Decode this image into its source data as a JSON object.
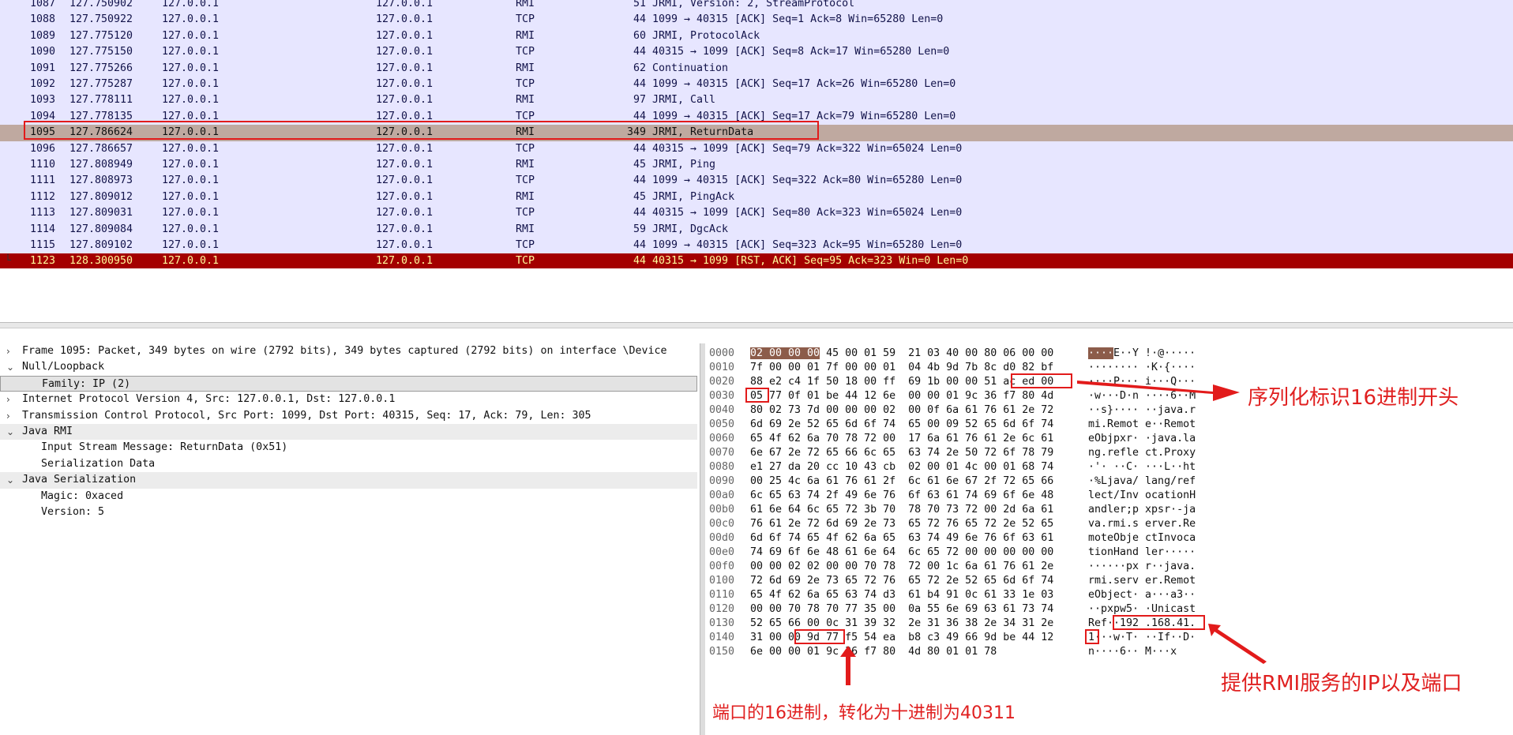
{
  "packets": [
    {
      "no": "1087",
      "time": "127.750902",
      "src": "127.0.0.1",
      "dst": "127.0.0.1",
      "proto": "RMI",
      "len": "51",
      "info": "JRMI, Version: 2, StreamProtocol"
    },
    {
      "no": "1088",
      "time": "127.750922",
      "src": "127.0.0.1",
      "dst": "127.0.0.1",
      "proto": "TCP",
      "len": "44",
      "info": "1099 → 40315 [ACK] Seq=1 Ack=8 Win=65280 Len=0"
    },
    {
      "no": "1089",
      "time": "127.775120",
      "src": "127.0.0.1",
      "dst": "127.0.0.1",
      "proto": "RMI",
      "len": "60",
      "info": "JRMI, ProtocolAck"
    },
    {
      "no": "1090",
      "time": "127.775150",
      "src": "127.0.0.1",
      "dst": "127.0.0.1",
      "proto": "TCP",
      "len": "44",
      "info": "40315 → 1099 [ACK] Seq=8 Ack=17 Win=65280 Len=0"
    },
    {
      "no": "1091",
      "time": "127.775266",
      "src": "127.0.0.1",
      "dst": "127.0.0.1",
      "proto": "RMI",
      "len": "62",
      "info": "Continuation"
    },
    {
      "no": "1092",
      "time": "127.775287",
      "src": "127.0.0.1",
      "dst": "127.0.0.1",
      "proto": "TCP",
      "len": "44",
      "info": "1099 → 40315 [ACK] Seq=17 Ack=26 Win=65280 Len=0"
    },
    {
      "no": "1093",
      "time": "127.778111",
      "src": "127.0.0.1",
      "dst": "127.0.0.1",
      "proto": "RMI",
      "len": "97",
      "info": "JRMI, Call"
    },
    {
      "no": "1094",
      "time": "127.778135",
      "src": "127.0.0.1",
      "dst": "127.0.0.1",
      "proto": "TCP",
      "len": "44",
      "info": "1099 → 40315 [ACK] Seq=17 Ack=79 Win=65280 Len=0"
    },
    {
      "no": "1095",
      "time": "127.786624",
      "src": "127.0.0.1",
      "dst": "127.0.0.1",
      "proto": "RMI",
      "len": "349",
      "info": "JRMI, ReturnData"
    },
    {
      "no": "1096",
      "time": "127.786657",
      "src": "127.0.0.1",
      "dst": "127.0.0.1",
      "proto": "TCP",
      "len": "44",
      "info": "40315 → 1099 [ACK] Seq=79 Ack=322 Win=65024 Len=0"
    },
    {
      "no": "1110",
      "time": "127.808949",
      "src": "127.0.0.1",
      "dst": "127.0.0.1",
      "proto": "RMI",
      "len": "45",
      "info": "JRMI, Ping"
    },
    {
      "no": "1111",
      "time": "127.808973",
      "src": "127.0.0.1",
      "dst": "127.0.0.1",
      "proto": "TCP",
      "len": "44",
      "info": "1099 → 40315 [ACK] Seq=322 Ack=80 Win=65280 Len=0"
    },
    {
      "no": "1112",
      "time": "127.809012",
      "src": "127.0.0.1",
      "dst": "127.0.0.1",
      "proto": "RMI",
      "len": "45",
      "info": "JRMI, PingAck"
    },
    {
      "no": "1113",
      "time": "127.809031",
      "src": "127.0.0.1",
      "dst": "127.0.0.1",
      "proto": "TCP",
      "len": "44",
      "info": "40315 → 1099 [ACK] Seq=80 Ack=323 Win=65024 Len=0"
    },
    {
      "no": "1114",
      "time": "127.809084",
      "src": "127.0.0.1",
      "dst": "127.0.0.1",
      "proto": "RMI",
      "len": "59",
      "info": "JRMI, DgcAck"
    },
    {
      "no": "1115",
      "time": "127.809102",
      "src": "127.0.0.1",
      "dst": "127.0.0.1",
      "proto": "TCP",
      "len": "44",
      "info": "1099 → 40315 [ACK] Seq=323 Ack=95 Win=65280 Len=0"
    },
    {
      "no": "1123",
      "time": "128.300950",
      "src": "127.0.0.1",
      "dst": "127.0.0.1",
      "proto": "TCP",
      "len": "44",
      "info": "40315 → 1099 [RST, ACK] Seq=95 Ack=323 Win=0 Len=0"
    }
  ],
  "details": [
    {
      "arrow": "›",
      "text": "Frame 1095: Packet, 349 bytes on wire (2792 bits), 349 bytes captured (2792 bits) on interface \\Device",
      "level": "top"
    },
    {
      "arrow": "⌄",
      "text": "Null/Loopback",
      "level": "top"
    },
    {
      "arrow": "",
      "text": "Family: IP (2)",
      "level": "child"
    },
    {
      "arrow": "›",
      "text": "Internet Protocol Version 4, Src: 127.0.0.1, Dst: 127.0.0.1",
      "level": "top"
    },
    {
      "arrow": "›",
      "text": "Transmission Control Protocol, Src Port: 1099, Dst Port: 40315, Seq: 17, Ack: 79, Len: 305",
      "level": "top"
    },
    {
      "arrow": "⌄",
      "text": "Java RMI",
      "level": "top"
    },
    {
      "arrow": "",
      "text": "Input Stream Message: ReturnData (0x51)",
      "level": "child"
    },
    {
      "arrow": "",
      "text": "Serialization Data",
      "level": "child"
    },
    {
      "arrow": "⌄",
      "text": "Java Serialization",
      "level": "top"
    },
    {
      "arrow": "",
      "text": "Magic: 0xaced",
      "level": "child"
    },
    {
      "arrow": "",
      "text": "Version: 5",
      "level": "child"
    }
  ],
  "hex_rows": [
    {
      "off": "0000",
      "hex": "02 00 00 00 45 00 01 59  21 03 40 00 80 06 00 00",
      "asc": "····E··Y !·@·····"
    },
    {
      "off": "0010",
      "hex": "7f 00 00 01 7f 00 00 01  04 4b 9d 7b 8c d0 82 bf",
      "asc": "········ ·K·{····"
    },
    {
      "off": "0020",
      "hex": "88 e2 c4 1f 50 18 00 ff  69 1b 00 00 51 ac ed 00",
      "asc": "····P··· i···Q···"
    },
    {
      "off": "0030",
      "hex": "05 77 0f 01 be 44 12 6e  00 00 01 9c 36 f7 80 4d",
      "asc": "·w···D·n ····6··M"
    },
    {
      "off": "0040",
      "hex": "80 02 73 7d 00 00 00 02  00 0f 6a 61 76 61 2e 72",
      "asc": "··s}···· ··java.r"
    },
    {
      "off": "0050",
      "hex": "6d 69 2e 52 65 6d 6f 74  65 00 09 52 65 6d 6f 74",
      "asc": "mi.Remot e··Remot"
    },
    {
      "off": "0060",
      "hex": "65 4f 62 6a 70 78 72 00  17 6a 61 76 61 2e 6c 61",
      "asc": "eObjpxr· ·java.la"
    },
    {
      "off": "0070",
      "hex": "6e 67 2e 72 65 66 6c 65  63 74 2e 50 72 6f 78 79",
      "asc": "ng.refle ct.Proxy"
    },
    {
      "off": "0080",
      "hex": "e1 27 da 20 cc 10 43 cb  02 00 01 4c 00 01 68 74",
      "asc": "·'· ··C· ···L··ht"
    },
    {
      "off": "0090",
      "hex": "00 25 4c 6a 61 76 61 2f  6c 61 6e 67 2f 72 65 66",
      "asc": "·%Ljava/ lang/ref"
    },
    {
      "off": "00a0",
      "hex": "6c 65 63 74 2f 49 6e 76  6f 63 61 74 69 6f 6e 48",
      "asc": "lect/Inv ocationH"
    },
    {
      "off": "00b0",
      "hex": "61 6e 64 6c 65 72 3b 70  78 70 73 72 00 2d 6a 61",
      "asc": "andler;p xpsr·-ja"
    },
    {
      "off": "00c0",
      "hex": "76 61 2e 72 6d 69 2e 73  65 72 76 65 72 2e 52 65",
      "asc": "va.rmi.s erver.Re"
    },
    {
      "off": "00d0",
      "hex": "6d 6f 74 65 4f 62 6a 65  63 74 49 6e 76 6f 63 61",
      "asc": "moteObje ctInvoca"
    },
    {
      "off": "00e0",
      "hex": "74 69 6f 6e 48 61 6e 64  6c 65 72 00 00 00 00 00",
      "asc": "tionHand ler·····"
    },
    {
      "off": "00f0",
      "hex": "00 00 02 02 00 00 70 78  72 00 1c 6a 61 76 61 2e",
      "asc": "······px r··java."
    },
    {
      "off": "0100",
      "hex": "72 6d 69 2e 73 65 72 76  65 72 2e 52 65 6d 6f 74",
      "asc": "rmi.serv er.Remot"
    },
    {
      "off": "0110",
      "hex": "65 4f 62 6a 65 63 74 d3  61 b4 91 0c 61 33 1e 03",
      "asc": "eObject· a···a3··"
    },
    {
      "off": "0120",
      "hex": "00 00 70 78 70 77 35 00  0a 55 6e 69 63 61 73 74",
      "asc": "··pxpw5· ·Unicast"
    },
    {
      "off": "0130",
      "hex": "52 65 66 00 0c 31 39 32  2e 31 36 38 2e 34 31 2e",
      "asc": "Ref··192 .168.41."
    },
    {
      "off": "0140",
      "hex": "31 00 00 9d 77 f5 54 ea  b8 c3 49 66 9d be 44 12",
      "asc": "1···w·T· ··If··D·"
    },
    {
      "off": "0150",
      "hex": "6e 00 00 01 9c 36 f7 80  4d 80 01 01 78",
      "asc": "n····6·· M···x"
    }
  ],
  "annotations": {
    "serialization_header": "序列化标识16进制开头",
    "rmi_ip_port": "提供RMI服务的IP以及端口",
    "port_hex": "端口的16进制，转化为十进制为40311"
  },
  "colors": {
    "row_bg": "#e7e6ff",
    "selected_bg": "#bfa9a0",
    "rst_bg": "#a40000",
    "annotation_red": "#e21b1b"
  }
}
